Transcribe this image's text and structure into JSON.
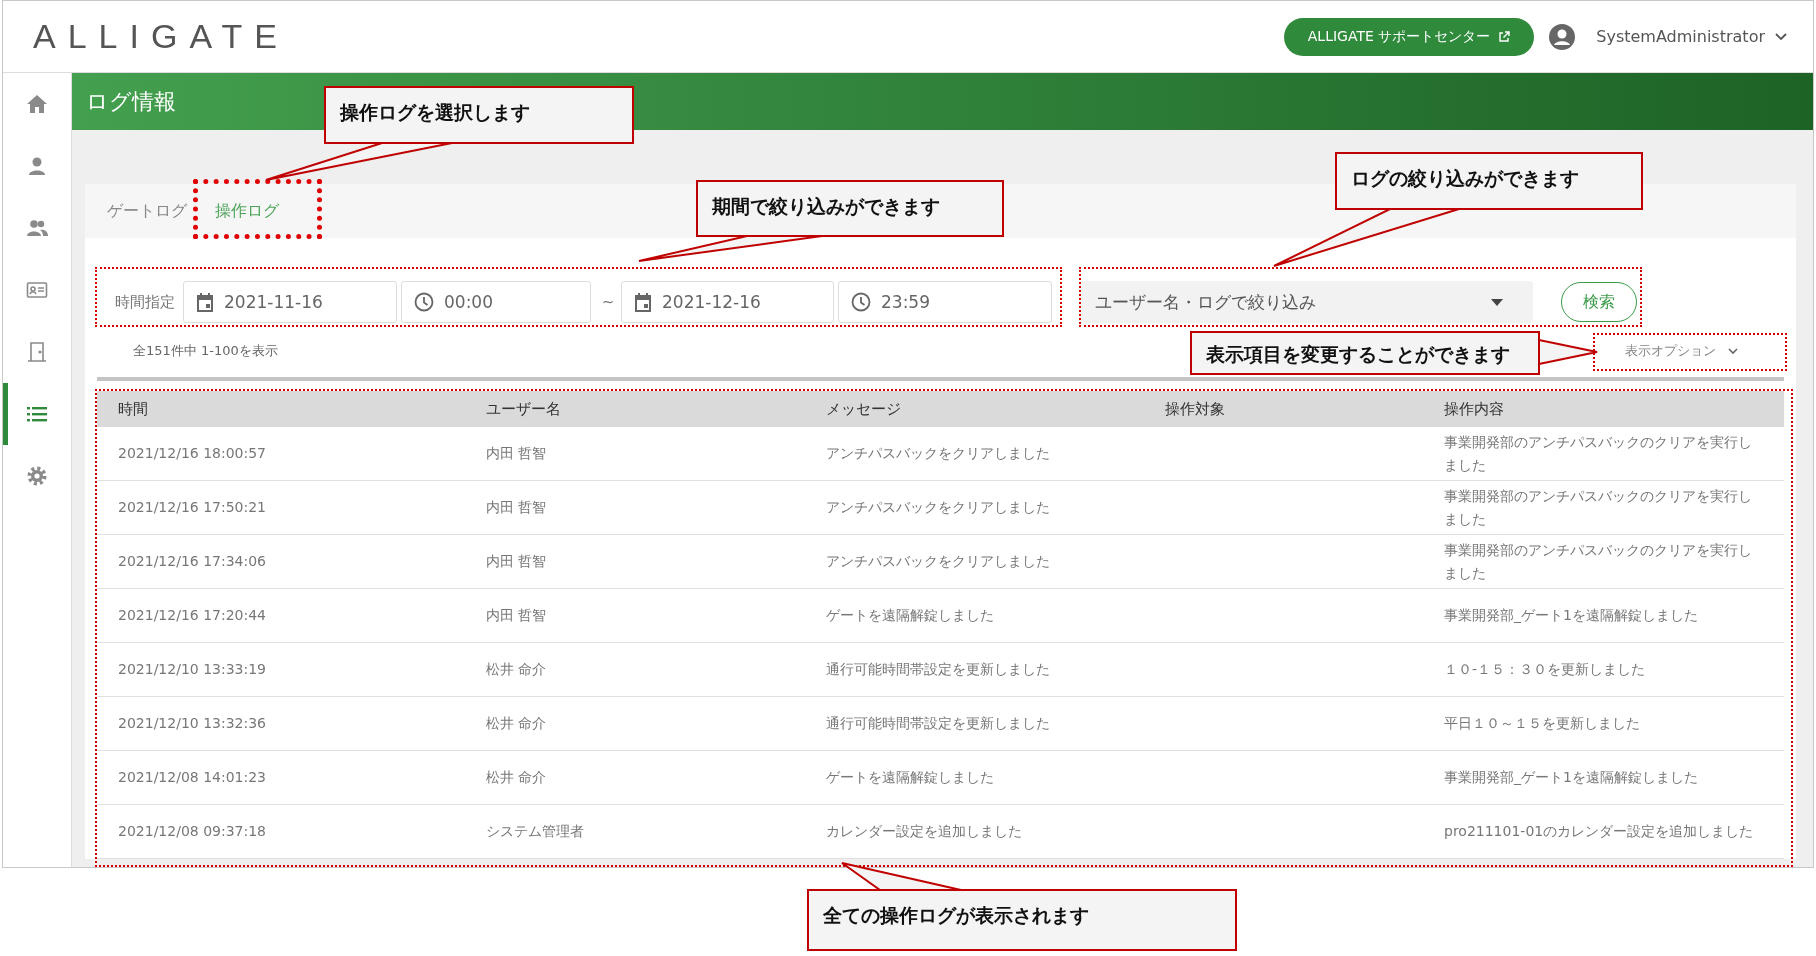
{
  "header": {
    "logo": "ALLIGATE",
    "support_button": "ALLIGATE サポートセンター",
    "user": "SystemAdministrator"
  },
  "sidebar": {
    "items": [
      {
        "kind": "home",
        "selected": false
      },
      {
        "kind": "user",
        "selected": false
      },
      {
        "kind": "users",
        "selected": false
      },
      {
        "kind": "card",
        "selected": false
      },
      {
        "kind": "door",
        "selected": false
      },
      {
        "kind": "list",
        "selected": true
      },
      {
        "kind": "gear",
        "selected": false
      }
    ]
  },
  "page_title": "ログ情報",
  "tabs": [
    {
      "label": "ゲートログ",
      "selected": false
    },
    {
      "label": "操作ログ",
      "selected": true
    }
  ],
  "filter": {
    "label": "時間指定",
    "start_date": "2021-11-16",
    "start_time": "00:00",
    "separator": "~",
    "end_date": "2021-12-16",
    "end_time": "23:59",
    "search": {
      "placeholder": "ユーザー名・ログで絞り込み"
    },
    "search_button": "検索"
  },
  "result_count": "全151件中 1-100を表示",
  "display_options": "表示オプション",
  "table": {
    "columns": [
      "時間",
      "ユーザー名",
      "メッセージ",
      "操作対象",
      "操作内容"
    ],
    "rows": [
      {
        "time": "2021/12/16 18:00:57",
        "user": "内田 哲智",
        "message": "アンチパスバックをクリアしました",
        "details": "事業開発部のアンチパスバックのクリアを実行しました"
      },
      {
        "time": "2021/12/16 17:50:21",
        "user": "内田 哲智",
        "message": "アンチパスバックをクリアしました",
        "details": "事業開発部のアンチパスバックのクリアを実行しました"
      },
      {
        "time": "2021/12/16 17:34:06",
        "user": "内田 哲智",
        "message": "アンチパスバックをクリアしました",
        "details": "事業開発部のアンチパスバックのクリアを実行しました"
      },
      {
        "time": "2021/12/16 17:20:44",
        "user": "内田 哲智",
        "message": "ゲートを遠隔解錠しました",
        "details": "事業開発部_ゲート1を遠隔解錠しました"
      },
      {
        "time": "2021/12/10 13:33:19",
        "user": "松井 命介",
        "message": "通行可能時間帯設定を更新しました",
        "details": "１０-１５：３０を更新しました"
      },
      {
        "time": "2021/12/10 13:32:36",
        "user": "松井 命介",
        "message": "通行可能時間帯設定を更新しました",
        "details": "平日１０～１５を更新しました"
      },
      {
        "time": "2021/12/08 14:01:23",
        "user": "松井 命介",
        "message": "ゲートを遠隔解錠しました",
        "details": "事業開発部_ゲート1を遠隔解錠しました"
      },
      {
        "time": "2021/12/08 09:37:18",
        "user": "システム管理者",
        "message": "カレンダー設定を追加しました",
        "details": "pro211101-01のカレンダー設定を追加しました"
      }
    ]
  },
  "annotations": [
    "操作ログを選択します",
    "期間で絞り込みができます",
    "ログの絞り込みができます",
    "表示項目を変更することができます",
    "全ての操作ログが表示されます"
  ]
}
